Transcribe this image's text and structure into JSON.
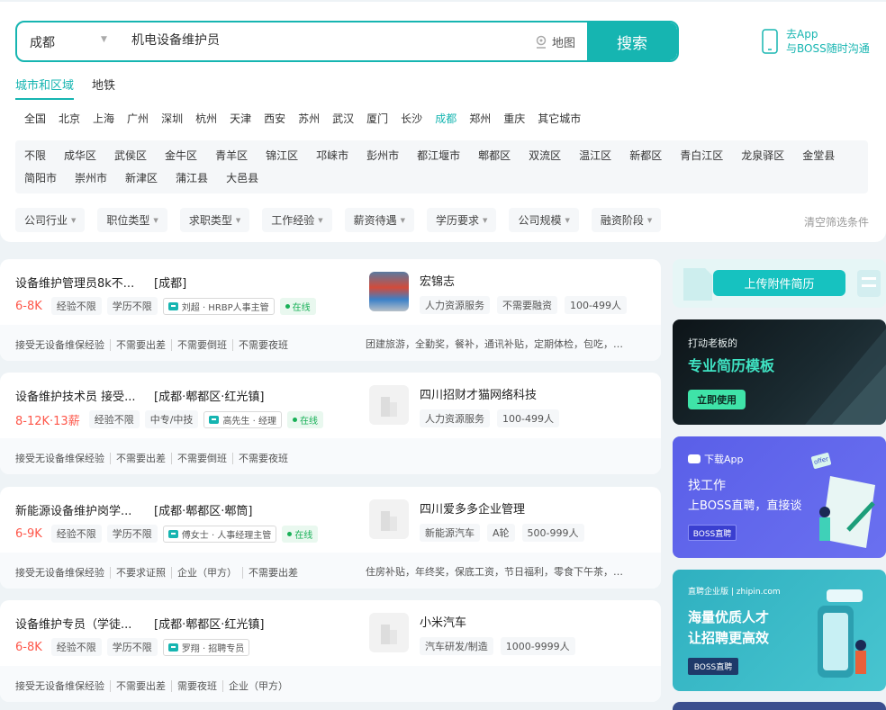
{
  "search": {
    "city": "成都",
    "query": "机电设备维护员",
    "map_label": "地图",
    "button": "搜索"
  },
  "app_promo": {
    "line1": "去App",
    "line2": "与BOSS随时沟通"
  },
  "tabs": [
    "城市和区域",
    "地铁"
  ],
  "cities": [
    "全国",
    "北京",
    "上海",
    "广州",
    "深圳",
    "杭州",
    "天津",
    "西安",
    "苏州",
    "武汉",
    "厦门",
    "长沙",
    "成都",
    "郑州",
    "重庆",
    "其它城市"
  ],
  "districts": [
    "不限",
    "成华区",
    "武侯区",
    "金牛区",
    "青羊区",
    "锦江区",
    "邛崃市",
    "彭州市",
    "都江堰市",
    "郫都区",
    "双流区",
    "温江区",
    "新都区",
    "青白江区",
    "龙泉驿区",
    "金堂县",
    "简阳市",
    "崇州市",
    "新津区",
    "蒲江县",
    "大邑县"
  ],
  "filters": [
    "公司行业",
    "职位类型",
    "求职类型",
    "工作经验",
    "薪资待遇",
    "学历要求",
    "公司规模",
    "融资阶段"
  ],
  "clear_filters": "清空筛选条件",
  "jobs": [
    {
      "title": "设备维护管理员8k不...",
      "area": "[成都]",
      "salary": "6-8K",
      "tags": [
        "经验不限",
        "学历不限"
      ],
      "recruiter": "刘超 · HRBP人事主管",
      "online": "在线",
      "company": "宏锦志",
      "company_tags": [
        "人力资源服务",
        "不需要融资",
        "100-499人"
      ],
      "skills": [
        "接受无设备维保经验",
        "不需要出差",
        "不需要倒班",
        "不需要夜班"
      ],
      "benefits": "团建旅游，全勤奖，餐补，通讯补贴，定期体检，包吃，住..."
    },
    {
      "title": "设备维护技术员 接受...",
      "area": "[成都·郫都区·红光镇]",
      "salary": "8-12K·13薪",
      "tags": [
        "经验不限",
        "中专/中技"
      ],
      "recruiter": "高先生 · 经理",
      "online": "在线",
      "company": "四川招财才猫网络科技",
      "company_tags": [
        "人力资源服务",
        "100-499人"
      ],
      "skills": [
        "接受无设备维保经验",
        "不需要出差",
        "不需要倒班",
        "不需要夜班"
      ],
      "benefits": ""
    },
    {
      "title": "新能源设备维护岗学...",
      "area": "[成都·郫都区·郫筒]",
      "salary": "6-9K",
      "tags": [
        "经验不限",
        "学历不限"
      ],
      "recruiter": "傅女士 · 人事经理主管",
      "online": "在线",
      "company": "四川爱多多企业管理",
      "company_tags": [
        "新能源汽车",
        "A轮",
        "500-999人"
      ],
      "skills": [
        "接受无设备维保经验",
        "不要求证照",
        "企业（甲方）",
        "不需要出差"
      ],
      "benefits": "住房补贴，年终奖，保底工资，节日福利，零食下午茶，宿..."
    },
    {
      "title": "设备维护专员（学徒...",
      "area": "[成都·郫都区·红光镇]",
      "salary": "6-8K",
      "tags": [
        "经验不限",
        "学历不限"
      ],
      "recruiter": "罗翔 · 招聘专员",
      "online": "",
      "company": "小米汽车",
      "company_tags": [
        "汽车研发/制造",
        "1000-9999人"
      ],
      "skills": [
        "接受无设备维保经验",
        "不需要出差",
        "需要夜班",
        "企业（甲方）"
      ],
      "benefits": ""
    }
  ],
  "side": {
    "upload": "上传附件简历",
    "template": {
      "line1": "打动老板的",
      "line2": "专业简历模板",
      "button": "立即使用"
    },
    "app": {
      "top": "下载App",
      "line1": "找工作",
      "line2": "上BOSS直聘，直接谈",
      "badge": "BOSS直聘",
      "offer": "offer"
    },
    "recruit": {
      "top": "直聘企业版 | zhipin.com",
      "line1": "海量优质人才",
      "line2": "让招聘更高效",
      "badge": "BOSS直聘"
    }
  },
  "colors": {
    "brand": "#16b5b1",
    "salary": "#fe574a",
    "online": "#18b057"
  }
}
